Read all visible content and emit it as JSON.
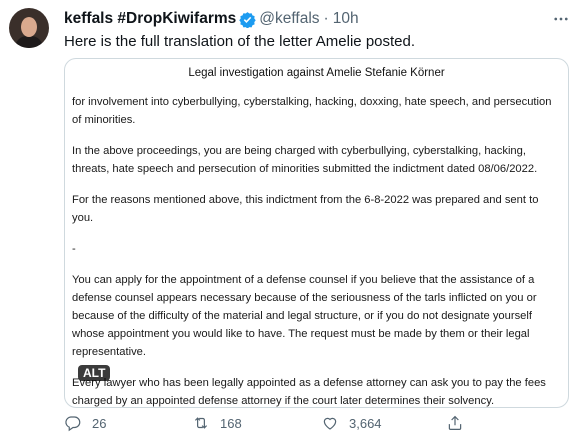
{
  "tweet": {
    "display_name": "keffals #DropKiwifarms",
    "handle": "@keffals",
    "separator": "·",
    "time": "10h",
    "text": "Here is the full translation of the letter Amelie posted."
  },
  "document": {
    "title": "Legal investigation against Amelie Stefanie Körner",
    "paragraphs": [
      "for involvement into cyberbullying, cyberstalking, hacking, doxxing, hate speech, and persecution of minorities.",
      "In the above proceedings, you are being charged with cyberbullying, cyberstalking, hacking, threats, hate speech and persecution of minorities submitted the indictment dated 08/06/2022.",
      "For the reasons mentioned above, this indictment from the 6-8-2022 was prepared and sent to you.",
      "-",
      "You can apply for the appointment of a defense counsel if you believe that the assistance of a defense counsel appears necessary because of the seriousness of the tarls inflicted on you or because of the difficulty of the material and legal structure, or if you do not designate yourself whose appointment you would like to have. The request must be made by them or their legal representative.",
      "Every lawyer who has been legally appointed as a defense attorney can ask you to pay the fees charged by an appointed defense attorney if the court later determines their solvency."
    ]
  },
  "media": {
    "alt_badge": "ALT"
  },
  "actions": {
    "replies": "26",
    "retweets": "168",
    "likes": "3,664"
  },
  "icons": {
    "verified": "verified-badge-icon",
    "more": "more-icon",
    "reply": "reply-icon",
    "retweet": "retweet-icon",
    "like": "heart-icon",
    "share": "share-icon"
  },
  "colors": {
    "verified": "#1d9bf0",
    "secondary_text": "#536471",
    "border": "#cfd9de"
  }
}
